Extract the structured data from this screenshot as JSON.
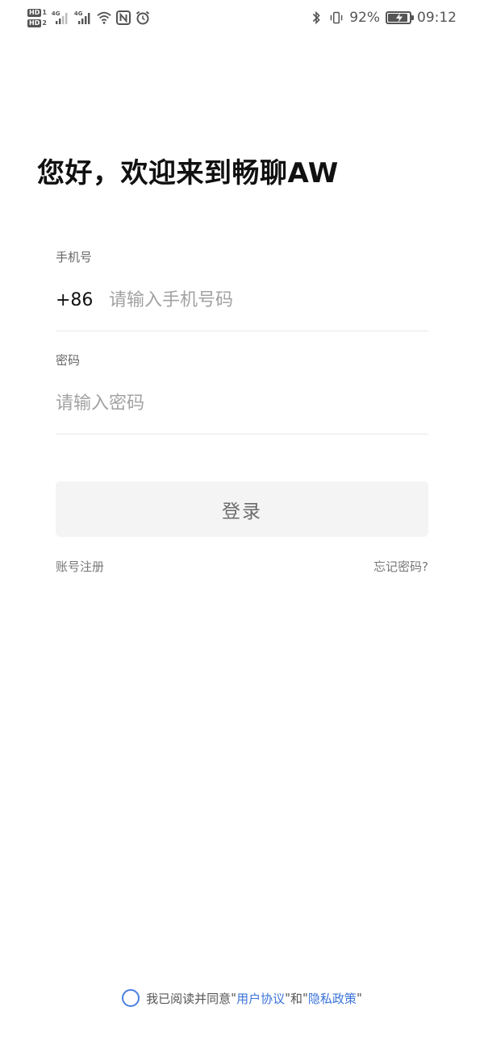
{
  "status_bar": {
    "sim1_label": "HD",
    "sim1_number": "1",
    "sim2_label": "HD",
    "sim2_number": "2",
    "network1": "4G",
    "network2": "4G",
    "icons_left": [
      "signal-icon",
      "signal-icon",
      "wifi-icon",
      "nfc-icon",
      "alarm-icon"
    ],
    "icons_right": [
      "bluetooth-icon",
      "vibrate-icon",
      "battery-icon"
    ],
    "battery_percent_text": "92%",
    "battery_level": 0.92,
    "charging": true,
    "time": "09:12",
    "icon_color": "#555555"
  },
  "welcome_title": "您好，欢迎来到畅聊AW",
  "phone": {
    "label": "手机号",
    "country_code": "+86",
    "placeholder": "请输入手机号码",
    "value": ""
  },
  "password": {
    "label": "密码",
    "placeholder": "请输入密码",
    "value": ""
  },
  "login_button_label": "登录",
  "register_link": "账号注册",
  "forgot_link": "忘记密码?",
  "agreement": {
    "checked": false,
    "prefix": "我已阅读并同意",
    "quote_open_1": "\"",
    "user_agreement": "用户协议",
    "quote_close_1": "\"",
    "conjunction": "和",
    "quote_open_2": "\"",
    "privacy_policy": "隐私政策",
    "quote_close_2": "\"",
    "link_color": "#3b73d9"
  },
  "colors": {
    "background": "#ffffff",
    "button_bg": "#f4f4f4",
    "accent": "#3b73d9"
  }
}
